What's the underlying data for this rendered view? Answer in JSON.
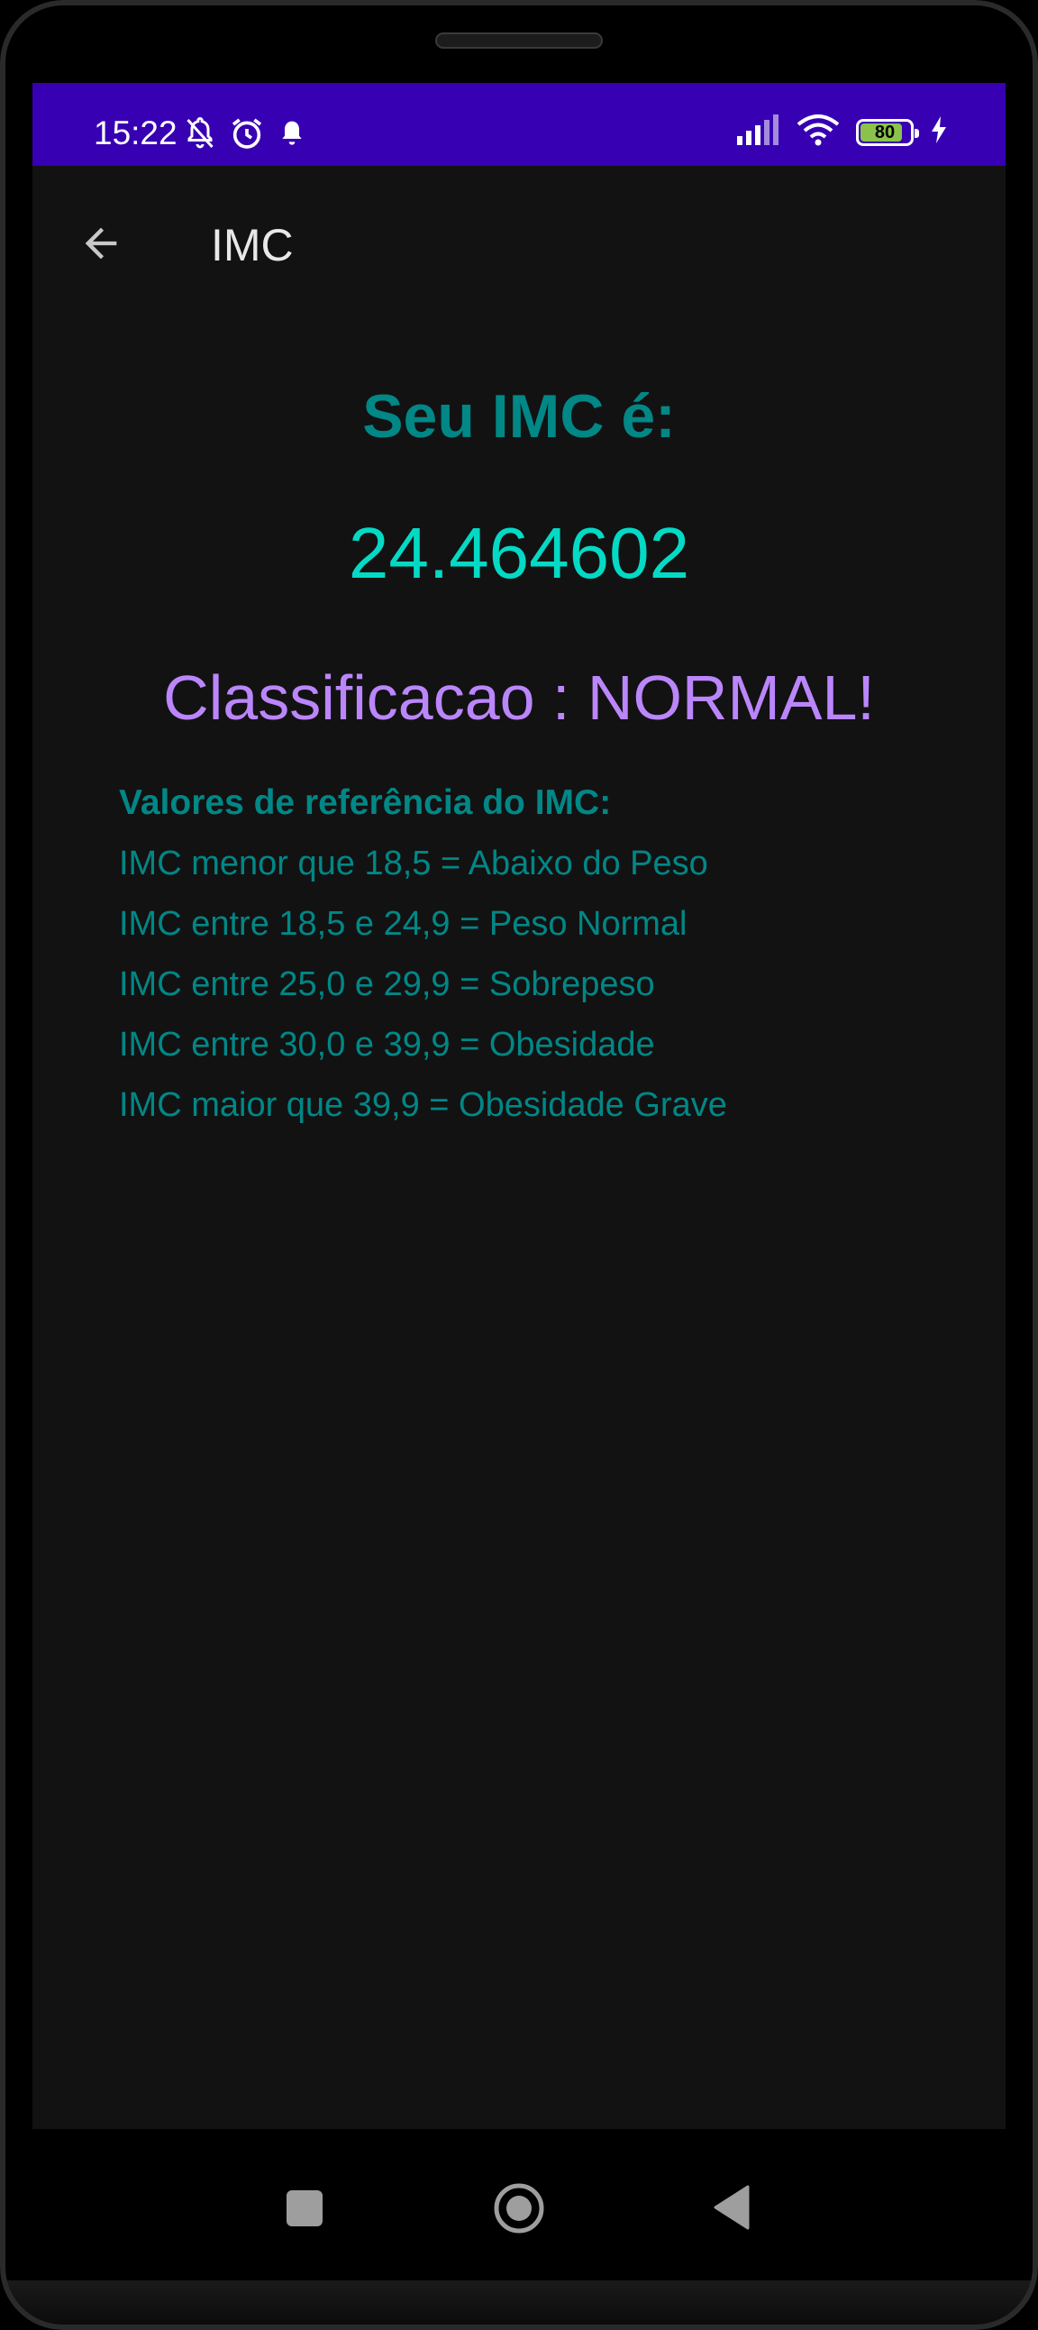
{
  "status_bar": {
    "time": "15:22",
    "battery_level": "80",
    "colors": {
      "background": "#3700b3",
      "battery_fill": "#8bc34a"
    },
    "icons": [
      "notifications-off-icon",
      "alarm-icon",
      "bell-icon",
      "signal-icon",
      "wifi-icon",
      "battery-icon",
      "charging-icon"
    ]
  },
  "app_bar": {
    "title": "IMC",
    "back_icon": "arrow-back-icon"
  },
  "result": {
    "label": "Seu IMC é:",
    "value": "24.464602",
    "classification": "Classificacao : NORMAL!"
  },
  "reference": {
    "title": "Valores de referência do IMC:",
    "lines": [
      "IMC menor que 18,5 = Abaixo do Peso",
      "IMC entre 18,5 e 24,9 = Peso Normal",
      "IMC entre 25,0 e 29,9 = Sobrepeso",
      "IMC entre 30,0 e 39,9 = Obesidade",
      "IMC maior que 39,9 = Obesidade Grave"
    ]
  },
  "nav_bar": {
    "icons": [
      "recents-square-icon",
      "home-circle-icon",
      "back-triangle-icon"
    ]
  },
  "colors": {
    "screen_background": "#121212",
    "teal": "#018786",
    "teal_light": "#03dac5",
    "purple": "#bb86fc"
  }
}
